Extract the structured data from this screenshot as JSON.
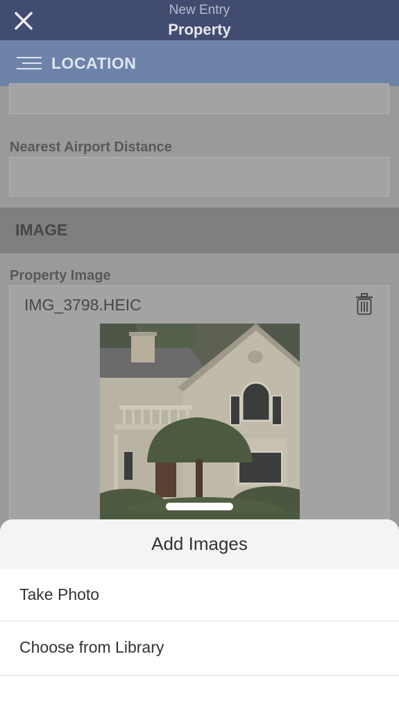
{
  "navbar": {
    "subtitle": "New Entry",
    "title": "Property",
    "close_icon": "close-icon"
  },
  "section_bar": {
    "title": "LOCATION",
    "menu_icon": "menu-icon"
  },
  "form": {
    "nearest_airport_label": "Nearest Airport Distance",
    "nearest_airport_value": "",
    "image_group_title": "IMAGE",
    "property_image_label": "Property Image",
    "image_file_name": "IMG_3798.HEIC",
    "trash_icon": "trash-icon"
  },
  "action_sheet": {
    "title": "Add Images",
    "options": [
      {
        "label": "Take Photo"
      },
      {
        "label": "Choose from Library"
      }
    ]
  },
  "colors": {
    "navbar": "#424c70",
    "section_bar": "#6e83a9",
    "dim_overlay_content": "#9a9a9a",
    "sheet_background": "#ffffff"
  }
}
